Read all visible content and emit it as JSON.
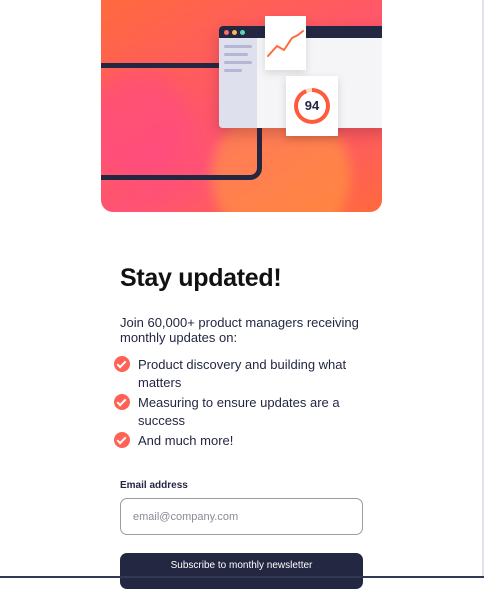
{
  "hero": {
    "score": "94",
    "icons": [
      "tablet-illustration",
      "browser-window-illustration",
      "chart-card",
      "score-ring"
    ]
  },
  "content": {
    "title": "Stay updated!",
    "intro": "Join 60,000+ product managers receiving monthly updates on:",
    "features": [
      "Product discovery and building what matters",
      "Measuring to ensure updates are a success",
      "And much more!"
    ]
  },
  "form": {
    "email_label": "Email address",
    "email_placeholder": "email@company.com",
    "email_value": "",
    "submit_label": "Subscribe to monthly newsletter"
  },
  "colors": {
    "accent": "#ff6155",
    "dark_navy": "#242742",
    "hero_gradient_start": "#ff6a3d",
    "hero_gradient_mid": "#ff5275"
  }
}
